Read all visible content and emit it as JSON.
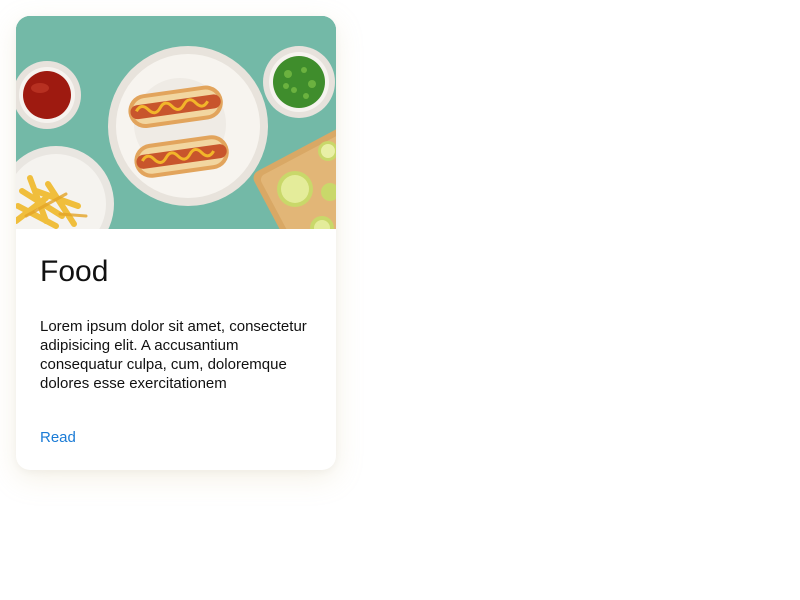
{
  "card": {
    "image_alt": "hot dogs, fries, ketchup, green onions and limes on a teal table",
    "title": "Food",
    "text": "Lorem ipsum dolor sit amet, consectetur adipisicing elit. A accusantium consequatur culpa, cum, doloremque dolores esse exercitationem",
    "link_label": "Read",
    "colors": {
      "background": "#ffffff",
      "table": "#6fb5a4",
      "link": "#1a7bd6",
      "text": "#111111"
    }
  }
}
